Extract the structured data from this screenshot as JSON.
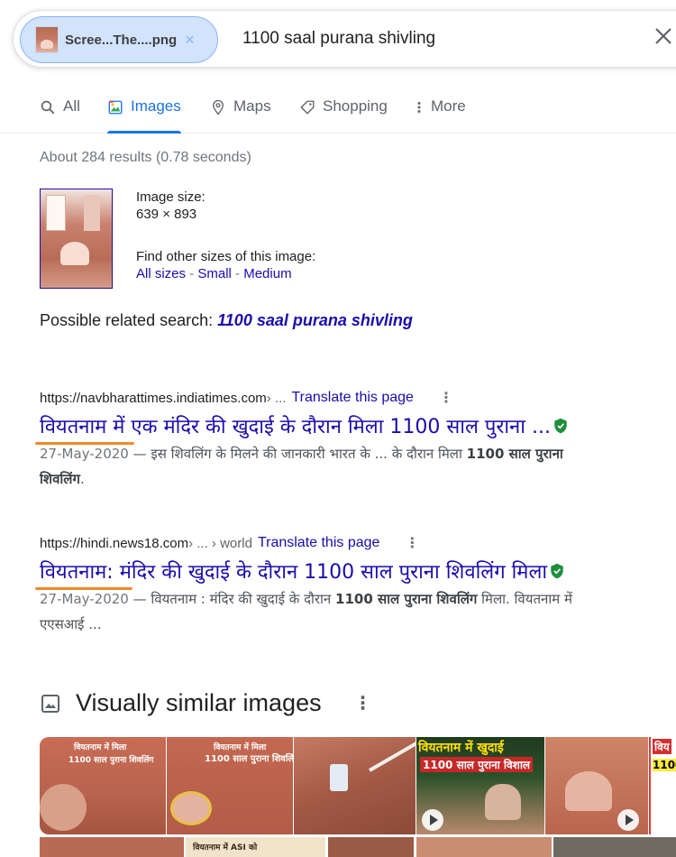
{
  "search": {
    "chip_label": "Scree...The....png",
    "chip_close": "×",
    "query": "1100 saal purana shivling"
  },
  "tabs": [
    {
      "label": "All",
      "icon": "search-icon"
    },
    {
      "label": "Images",
      "icon": "image-icon",
      "active": true
    },
    {
      "label": "Maps",
      "icon": "map-pin-icon"
    },
    {
      "label": "Shopping",
      "icon": "tag-icon"
    },
    {
      "label": "More",
      "icon": "more-vert-icon"
    }
  ],
  "results_count": "About 284 results (0.78 seconds)",
  "image_info": {
    "size_label": "Image size:",
    "size_value": "639 × 893",
    "find_label": "Find other sizes of this image:",
    "all_sizes": "All sizes",
    "small": "Small",
    "medium": "Medium",
    "separator": " - "
  },
  "related": {
    "label": "Possible related search:",
    "query": "1100 saal purana shivling"
  },
  "results": [
    {
      "url": "https://navbharattimes.indiatimes.com",
      "crumbs": " › ...",
      "translate": "Translate this page",
      "title": "वियतनाम में एक मंदिर की खुदाई के दौरान मिला 1100 साल पुराना ...",
      "date": "27-May-2020",
      "snippet_pre": " — इस शिवलिंग के मिलने की जानकारी भारत के ... के दौरान मिला ",
      "snippet_bold": "1100 साल पुराना",
      "snippet_line2": "शिवलिंग",
      "snippet_post": "."
    },
    {
      "url": "https://hindi.news18.com",
      "crumbs": " › ... › world",
      "translate": "Translate this page",
      "title_first": "वियतनाम",
      "title_rest": " : मंदिर की खुदाई के दौरान 1100 साल पुराना शिवलिंग मिला",
      "date": "27-May-2020",
      "snippet_pre": " — वियतनाम : मंदिर की खुदाई के दौरान ",
      "snippet_bold": "1100 साल पुराना शिवलिंग",
      "snippet_post": " मिला. वियतनाम में",
      "snippet_line2": "एएसआई ..."
    }
  ],
  "visually_similar": {
    "title": "Visually similar images",
    "captions": [
      "वियतनाम में मिला",
      "1100 साल पुराना शिवलिंग",
      "वियतनाम में मिला",
      "1100 साल पुराना शिवलिं",
      "वियतनाम में खुदाई",
      "1100 साल पुराना विशाल",
      "विय",
      "1100",
      "वियतनाम में ASI को"
    ]
  },
  "colors": {
    "link": "#1a0dab",
    "accent": "#1a73e8",
    "annotation": "#f4892a",
    "verified": "#1e8e3e"
  }
}
